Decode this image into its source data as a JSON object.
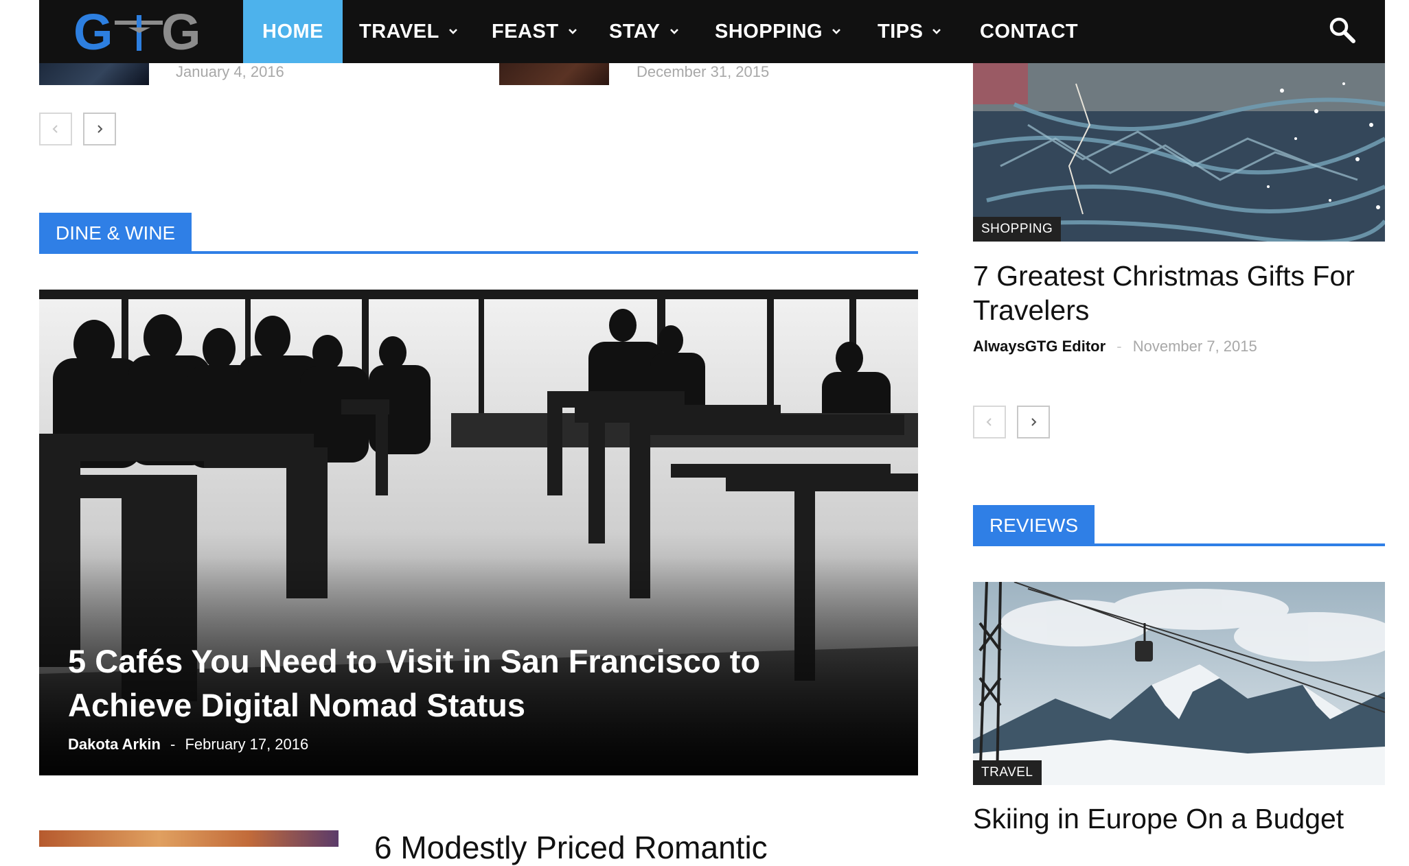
{
  "nav": {
    "logo_text": "GTG",
    "items": [
      {
        "label": "HOME",
        "active": true,
        "dropdown": false
      },
      {
        "label": "TRAVEL",
        "active": false,
        "dropdown": true
      },
      {
        "label": "FEAST",
        "active": false,
        "dropdown": true
      },
      {
        "label": "STAY",
        "active": false,
        "dropdown": true
      },
      {
        "label": "SHOPPING",
        "active": false,
        "dropdown": true
      },
      {
        "label": "TIPS",
        "active": false,
        "dropdown": true
      },
      {
        "label": "CONTACT",
        "active": false,
        "dropdown": false
      }
    ],
    "search_icon": "search-icon"
  },
  "above": {
    "date_left": "January 4, 2016",
    "date_right": "December 31, 2015"
  },
  "dine_wine": {
    "tag": "DINE & WINE",
    "hero": {
      "title": "5 Cafés You Need to Visit in San Francisco to Achieve Digital Nomad Status",
      "author": "Dakota Arkin",
      "separator": "-",
      "date": "February 17, 2016"
    },
    "next_title": "6 Modestly Priced Romantic"
  },
  "sidebar": {
    "post1": {
      "category": "SHOPPING",
      "title": "7 Greatest Christmas Gifts For Travelers",
      "author": "AlwaysGTG Editor",
      "separator": "-",
      "date": "November 7, 2015"
    },
    "reviews_tag": "REVIEWS",
    "post2": {
      "category": "TRAVEL",
      "title": "Skiing in Europe On a Budget"
    }
  },
  "colors": {
    "nav_bg": "#111111",
    "accent_active": "#4db2ec",
    "section_blue": "#2f7fe6",
    "logo_blue": "#2d7fe0",
    "logo_grey": "#8c8c8c"
  }
}
